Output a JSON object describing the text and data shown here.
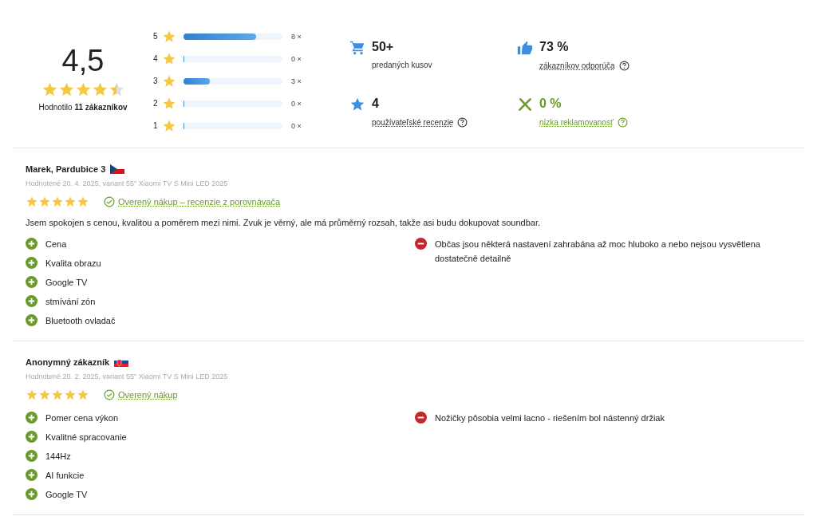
{
  "summary": {
    "score": "4,5",
    "stars": 4.5,
    "rated_by": "Hodnotilo **11 zákazníkov**",
    "distribution": [
      {
        "label": "5",
        "level": 0.73,
        "count": "8 ×"
      },
      {
        "label": "4",
        "level": 0,
        "count": "0 ×"
      },
      {
        "label": "3",
        "level": 0.27,
        "count": "3 ×"
      },
      {
        "label": "2",
        "level": 0,
        "count": "0 ×"
      },
      {
        "label": "1",
        "level": 0,
        "count": "0 ×"
      }
    ],
    "stats": [
      {
        "kind": "cart",
        "value": "50+",
        "label": "predaných kusov",
        "link": false,
        "help": false
      },
      {
        "kind": "thumb",
        "value": "73 %",
        "label": "zákazníkov odporúča",
        "link": true,
        "help": true
      },
      {
        "kind": "star",
        "value": "4",
        "label": "používateľské recenzie",
        "link": true,
        "help": true
      },
      {
        "kind": "tools",
        "value": "0 %",
        "label": "nízka reklamovanosť",
        "link": true,
        "help": true
      }
    ]
  },
  "reviews": [
    {
      "author": "Marek, Pardubice 3",
      "kind": "cz",
      "meta": "Hodnotené 20. 4. 2025, variant 55\" Xiaomi TV S Mini LED 2025",
      "stars": 5,
      "verified": "Overený nákup – recenzie z porovnávača",
      "text": "Jsem spokojen s cenou, kvalitou a poměrem mezi nimi. Zvuk je věrný, ale má průměrný rozsah, takže asi budu dokupovat soundbar.",
      "pros": [
        "Cena",
        "Kvalita obrazu",
        "Google TV",
        "stmívání zón",
        "Bluetooth ovladač"
      ],
      "cons": [
        "Občas jsou některá nastavení zahrabána až moc hluboko a nebo nejsou vysvětlena dostatečně detailně"
      ]
    },
    {
      "author": "Anonymný zákazník",
      "kind": "sk",
      "meta": "Hodnotené 20. 2. 2025, variant 55\" Xiaomi TV S Mini LED 2025",
      "stars": 5,
      "verified": "Overený nákup",
      "pros": [
        "Pomer cena výkon",
        "Kvalitné spracovanie",
        "144Hz",
        "AI funkcie",
        "Google TV"
      ],
      "cons": [
        "Nožičky pôsobia velmi lacno - riešením bol nástenný držiak"
      ]
    }
  ]
}
